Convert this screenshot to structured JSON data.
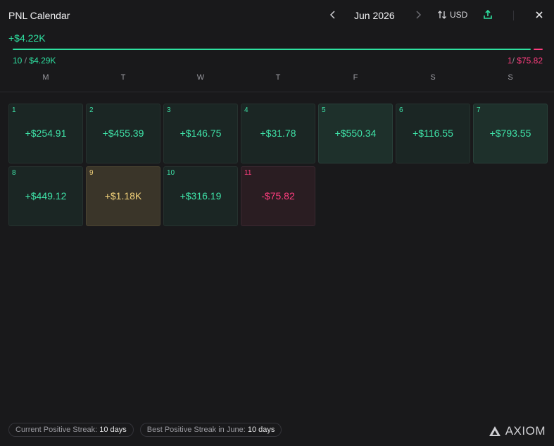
{
  "header": {
    "title": "PNL Calendar",
    "month": "Jun 2026",
    "prev_icon": "chevron-left-icon",
    "next_icon": "chevron-right-icon",
    "currency_label": "USD",
    "currency_icon": "swap-icon",
    "share_icon": "share-icon",
    "close_icon": "close-icon"
  },
  "summary": {
    "total": "+$4.22K",
    "positive_count": "10",
    "positive_separator": "/",
    "positive_amount": "$4.29K",
    "negative_count": "1",
    "negative_separator": "/",
    "negative_amount": "$75.82",
    "positive_share": 0.983
  },
  "weekdays": [
    "M",
    "T",
    "W",
    "T",
    "F",
    "S",
    "S"
  ],
  "days": [
    {
      "day": "1",
      "value": "+$254.91",
      "kind": "pos"
    },
    {
      "day": "2",
      "value": "+$455.39",
      "kind": "pos"
    },
    {
      "day": "3",
      "value": "+$146.75",
      "kind": "pos"
    },
    {
      "day": "4",
      "value": "+$31.78",
      "kind": "pos"
    },
    {
      "day": "5",
      "value": "+$550.34",
      "kind": "pos-2"
    },
    {
      "day": "6",
      "value": "+$116.55",
      "kind": "pos"
    },
    {
      "day": "7",
      "value": "+$793.55",
      "kind": "pos-2"
    },
    {
      "day": "8",
      "value": "+$449.12",
      "kind": "pos"
    },
    {
      "day": "9",
      "value": "+$1.18K",
      "kind": "gold"
    },
    {
      "day": "10",
      "value": "+$316.19",
      "kind": "pos"
    },
    {
      "day": "11",
      "value": "-$75.82",
      "kind": "neg"
    }
  ],
  "footer": {
    "current_streak_label": "Current Positive Streak:",
    "current_streak_value": "10 days",
    "best_streak_label": "Best Positive Streak in June:",
    "best_streak_value": "10 days",
    "logo_text": "AXIOM"
  },
  "colors": {
    "positive": "#2ee0a0",
    "negative": "#ff3d7f",
    "highlight": "#f3d27a",
    "background": "#19191b"
  }
}
